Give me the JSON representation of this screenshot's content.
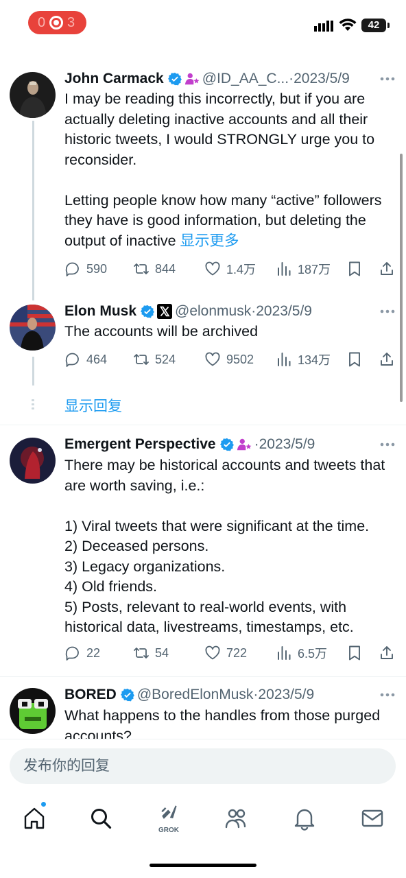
{
  "status_bar": {
    "battery": "42"
  },
  "tweets": [
    {
      "name": "John Carmack",
      "handle": "@ID_AA_C...",
      "separator": "·",
      "date": "2023/5/9",
      "text": "I may be reading this incorrectly, but if you are actually deleting inactive accounts and all their historic tweets, I would STRONGLY urge you to reconsider.\n\nLetting people know how many “active” followers they have is good information, but deleting the output of inactive ",
      "show_more": "显示更多",
      "replies": "590",
      "retweets": "844",
      "likes": "1.4万",
      "views": "187万"
    },
    {
      "name": "Elon Musk",
      "handle": "@elonmusk",
      "separator": "·",
      "date": "2023/5/9",
      "text": "The accounts will be archived",
      "replies": "464",
      "retweets": "524",
      "likes": "9502",
      "views": "134万"
    },
    {
      "name": "Emergent Perspective",
      "separator": "·",
      "date": "2023/5/9",
      "text": "There may be historical accounts and tweets that are worth saving, i.e.:\n\n1) Viral tweets that were significant at the time.\n2) Deceased persons.\n3) Legacy organizations.\n4) Old friends.\n5) Posts, relevant to real-world events, with historical data, livestreams, timestamps, etc.",
      "replies": "22",
      "retweets": "54",
      "likes": "722",
      "views": "6.5万"
    },
    {
      "name": "BORED",
      "handle": "@BoredElonMusk",
      "separator": "·",
      "date": "2023/5/9",
      "text": "What happens to the handles from those purged accounts?"
    }
  ],
  "show_replies": "显示回复",
  "composer": {
    "placeholder": "发布你的回复"
  },
  "nav": {
    "grok_label": "GROK"
  },
  "colors": {
    "accent": "#1d9bf0",
    "text": "#0f1419",
    "muted": "#536471",
    "record": "#e8423b",
    "verified": "#1d9bf0"
  }
}
